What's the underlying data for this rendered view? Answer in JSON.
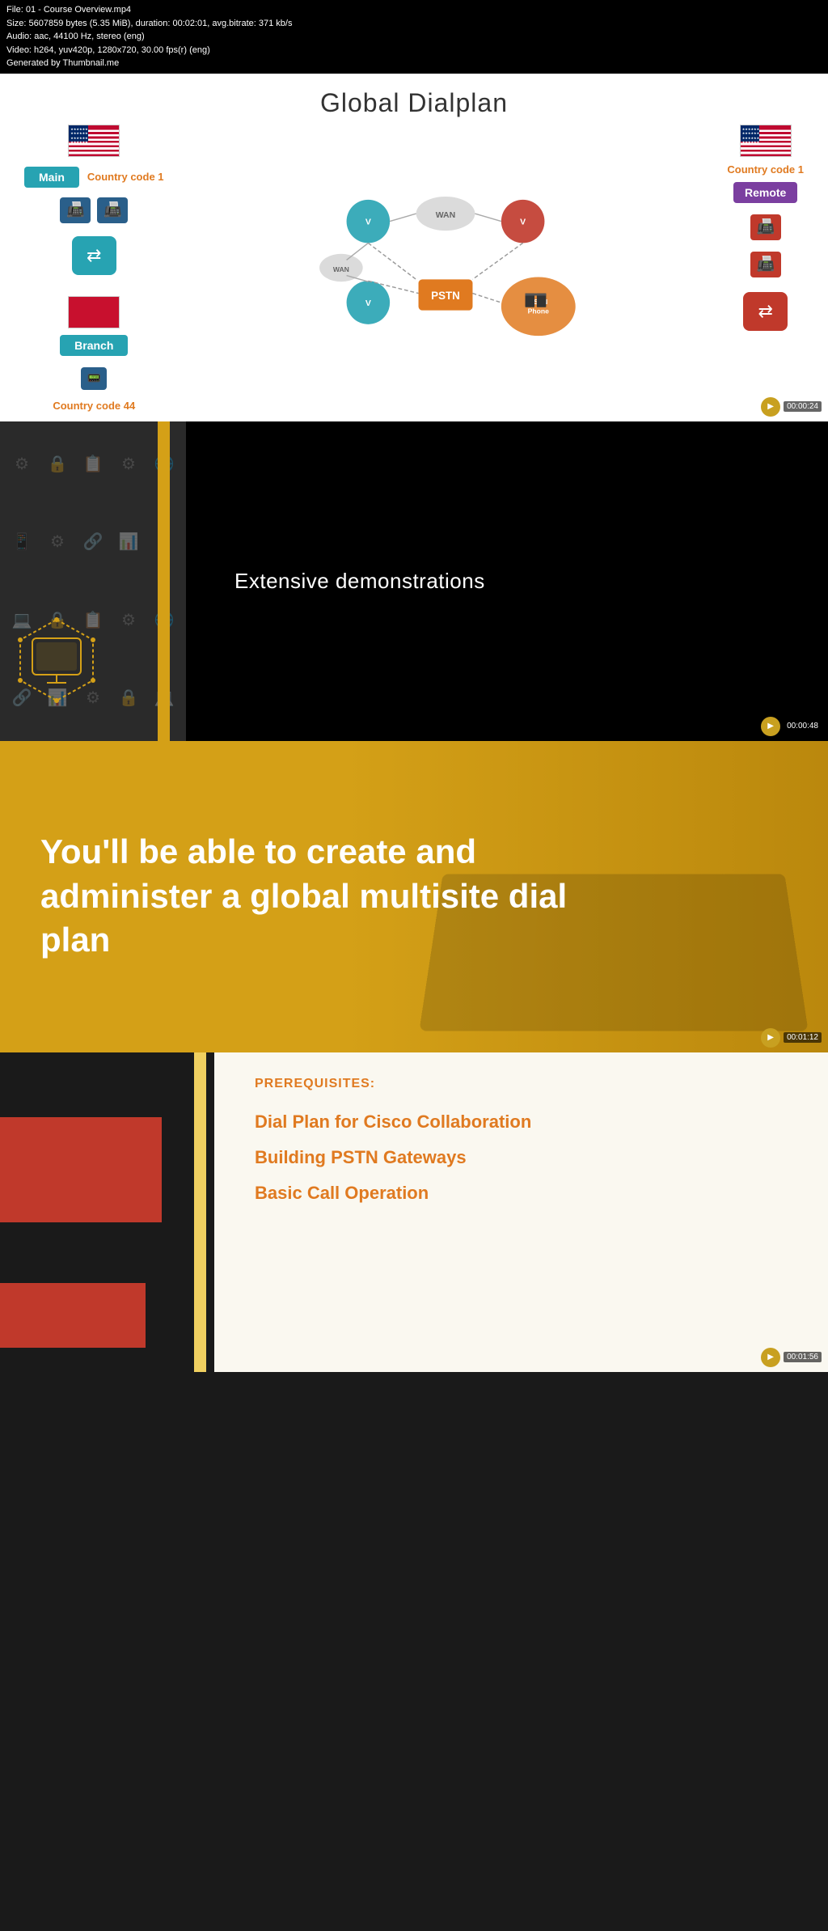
{
  "fileInfo": {
    "line1": "File: 01 - Course Overview.mp4",
    "line2": "Size: 5607859 bytes (5.35 MiB), duration: 00:02:01, avg.bitrate: 371 kb/s",
    "line3": "Audio: aac, 44100 Hz, stereo (eng)",
    "line4": "Video: h264, yuv420p, 1280x720, 30.00 fps(r) (eng)",
    "line5": "Generated by Thumbnail.me"
  },
  "slide1": {
    "title": "Global Dialplan",
    "leftSide": {
      "countryCodeTop": "Country code 1",
      "mainLabel": "Main",
      "countryCodeBottom": "Country code 44",
      "branchLabel": "Branch"
    },
    "rightSide": {
      "countryCodeTop": "Country code 1",
      "remoteLabel": "Remote"
    },
    "center": {
      "pstnLabel": "PSTN",
      "wanLabel": "WAN",
      "pstnPhoneLabel": "PSTN Phone"
    },
    "timestamp": "00:00:24"
  },
  "slide2": {
    "text": "Extensive demonstrations",
    "timestamp": "00:00:48"
  },
  "slide3": {
    "text": "You'll be able to create and administer a global multisite dial plan",
    "timestamp": "00:01:12"
  },
  "slide4": {
    "prerequisites_label": "PREREQUISITES:",
    "items": [
      "Dial Plan for Cisco Collaboration",
      "Building PSTN Gateways",
      "Basic Call Operation"
    ],
    "timestamp": "00:01:56"
  }
}
